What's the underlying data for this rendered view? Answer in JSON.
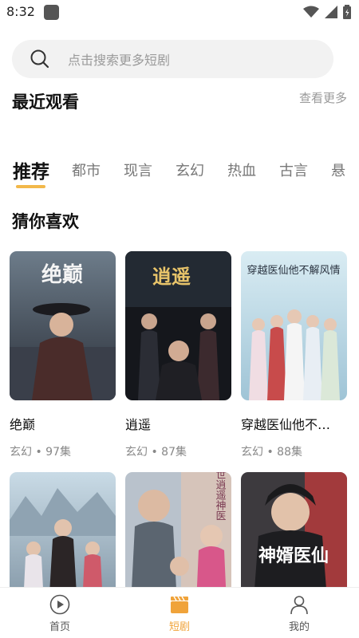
{
  "status_bar": {
    "time": "8:32"
  },
  "search": {
    "placeholder": "点击搜索更多短剧"
  },
  "recent": {
    "title": "最近观看",
    "more": "查看更多"
  },
  "tabs": [
    "推荐",
    "都市",
    "现言",
    "玄幻",
    "热血",
    "古言",
    "悬"
  ],
  "active_tab": "推荐",
  "recommend": {
    "title": "猜你喜欢",
    "items": [
      {
        "title": "绝巅",
        "meta": "玄幻 • 97集",
        "poster_text": "绝巅"
      },
      {
        "title": "逍遥",
        "meta": "玄幻 • 87集",
        "poster_text": "逍遥"
      },
      {
        "title": "穿越医仙他不…",
        "meta": "玄幻 • 88集",
        "poster_text": "穿越医仙他不解风情"
      },
      {
        "title": "",
        "meta": "",
        "poster_text": ""
      },
      {
        "title": "",
        "meta": "",
        "poster_text": "旷世逍遥神医"
      },
      {
        "title": "",
        "meta": "",
        "poster_text": "神婿医仙"
      }
    ]
  },
  "bottom_nav": {
    "items": [
      {
        "label": "首页",
        "icon": "play-circle-icon"
      },
      {
        "label": "短剧",
        "icon": "clapperboard-icon"
      },
      {
        "label": "我的",
        "icon": "user-icon"
      }
    ],
    "active": "短剧"
  },
  "colors": {
    "accent": "#f2b84a",
    "active_nav": "#f0a33a",
    "search_bg": "#f2f2f2"
  }
}
